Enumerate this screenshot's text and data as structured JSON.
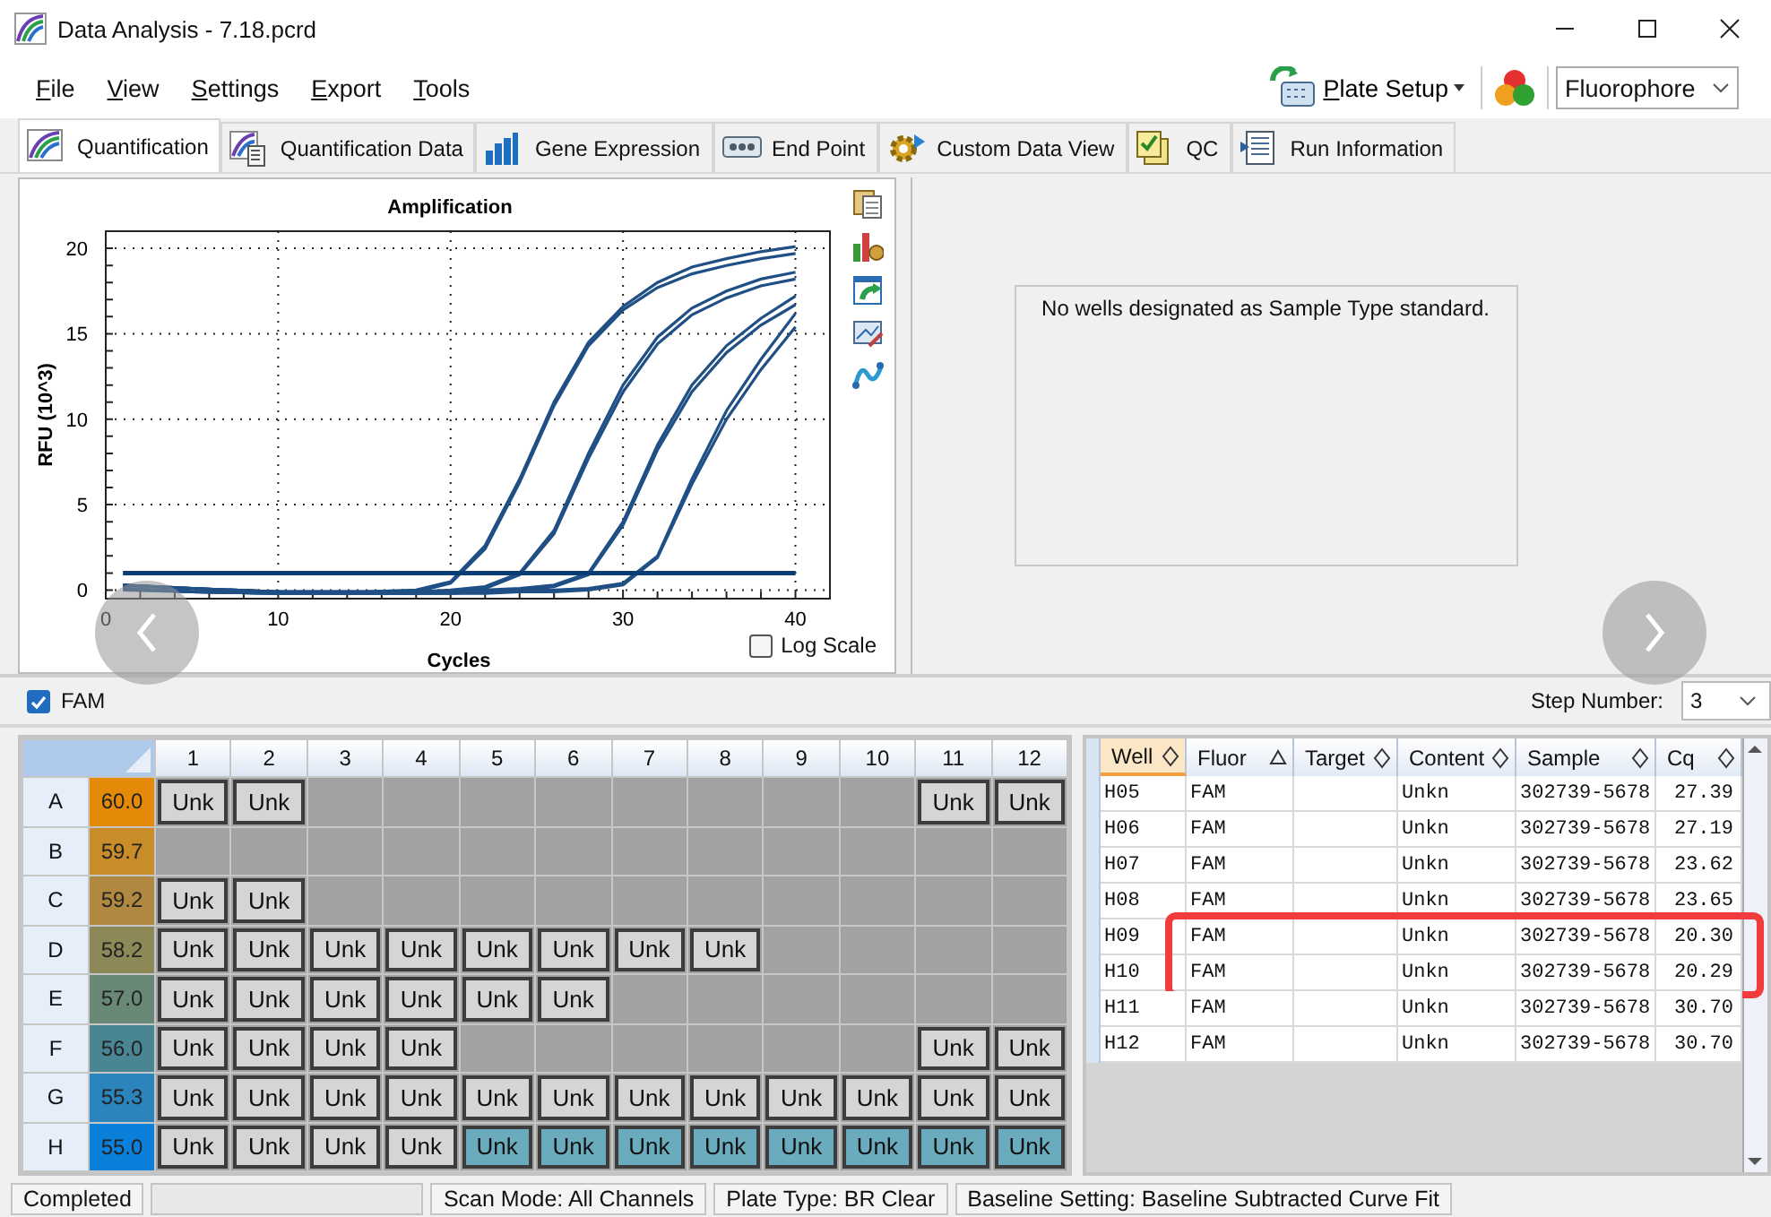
{
  "window": {
    "title": "Data Analysis - 7.18.pcrd"
  },
  "menu": [
    {
      "label": "File"
    },
    {
      "label": "View"
    },
    {
      "label": "Settings"
    },
    {
      "label": "Export"
    },
    {
      "label": "Tools"
    }
  ],
  "toolbar": {
    "plate_setup": {
      "label": "Plate Setup"
    },
    "fluorophore_select": {
      "value": "Fluorophore"
    }
  },
  "tabs": [
    {
      "label": "Quantification",
      "kind": "curves",
      "selected": true
    },
    {
      "label": "Quantification Data",
      "kind": "curves-doc",
      "selected": false
    },
    {
      "label": "Gene Expression",
      "kind": "bars",
      "selected": false
    },
    {
      "label": "End Point",
      "kind": "dots",
      "selected": false
    },
    {
      "label": "Custom Data View",
      "kind": "gear",
      "selected": false
    },
    {
      "label": "QC",
      "kind": "checklist",
      "selected": false
    },
    {
      "label": "Run Information",
      "kind": "list",
      "selected": false
    }
  ],
  "chart": {
    "chart_data": {
      "type": "line",
      "title": "Amplification",
      "xlabel": "Cycles",
      "ylabel": "RFU (10^3)",
      "grid": true,
      "x": [
        1,
        5,
        10,
        15,
        18,
        20,
        22,
        24,
        26,
        28,
        30,
        32,
        34,
        36,
        38,
        40
      ],
      "series": [
        {
          "color": "#1f4f85",
          "values": [
            0.3,
            0.1,
            -0.1,
            -0.1,
            0,
            0.5,
            2.6,
            6.5,
            11,
            14.5,
            16.6,
            18,
            18.9,
            19.4,
            19.8,
            20.1
          ]
        },
        {
          "color": "#1f4f85",
          "values": [
            0.1,
            -0.1,
            -0.2,
            -0.2,
            -0.1,
            0.4,
            2.4,
            6.3,
            10.8,
            14.3,
            16.4,
            17.7,
            18.5,
            19,
            19.4,
            19.7
          ]
        },
        {
          "color": "#1f4f85",
          "values": [
            0.3,
            0.1,
            -0.1,
            -0.1,
            -0.1,
            0,
            0.2,
            1,
            3.5,
            8,
            12,
            14.8,
            16.5,
            17.5,
            18.2,
            18.6
          ]
        },
        {
          "color": "#1f4f85",
          "values": [
            0,
            -0.1,
            -0.2,
            -0.2,
            -0.2,
            -0.1,
            0.1,
            0.9,
            3.3,
            7.7,
            11.6,
            14.4,
            16.1,
            17.1,
            17.8,
            18.2
          ]
        },
        {
          "color": "#1f4f85",
          "values": [
            0.3,
            0.1,
            -0.1,
            -0.1,
            -0.1,
            -0.1,
            0,
            0.1,
            0.3,
            1,
            4,
            8.5,
            12,
            14.3,
            15.9,
            17.2
          ]
        },
        {
          "color": "#1f4f85",
          "values": [
            0.1,
            -0.1,
            -0.2,
            -0.2,
            -0.2,
            -0.2,
            -0.1,
            0,
            0.2,
            0.9,
            3.8,
            8.2,
            11.6,
            13.9,
            15.5,
            16.7
          ]
        },
        {
          "color": "#1f4f85",
          "values": [
            0.3,
            0.1,
            -0.1,
            -0.1,
            -0.1,
            -0.1,
            -0.1,
            0,
            0,
            0.1,
            0.4,
            2,
            6.5,
            10.5,
            13.5,
            16.2
          ]
        },
        {
          "color": "#1f4f85",
          "values": [
            0.1,
            -0.1,
            -0.2,
            -0.2,
            -0.2,
            -0.2,
            -0.2,
            -0.1,
            -0.1,
            0,
            0.3,
            1.9,
            6.2,
            10,
            12.9,
            15.4
          ]
        },
        {
          "color": "#0b3d75",
          "values": [
            1,
            1,
            1,
            1,
            1,
            1,
            1,
            1,
            1,
            1,
            1,
            1,
            1,
            1,
            1,
            1
          ]
        }
      ],
      "xlim": [
        0,
        42
      ],
      "ylim": [
        -0.5,
        21
      ],
      "xticks": [
        0,
        10,
        20,
        30,
        40
      ],
      "yticks": [
        0,
        5,
        10,
        15,
        20
      ]
    },
    "log_scale": {
      "label": "Log Scale",
      "checked": false
    }
  },
  "standard_panel": {
    "message": "No wells designated as Sample Type standard."
  },
  "fluor_filter": {
    "label": "FAM",
    "checked": true
  },
  "step_number": {
    "label": "Step Number:",
    "value": "3"
  },
  "plate": {
    "columns": [
      "1",
      "2",
      "3",
      "4",
      "5",
      "6",
      "7",
      "8",
      "9",
      "10",
      "11",
      "12"
    ],
    "rows": [
      {
        "label": "A",
        "temp": "60.0",
        "color": "#e58a08",
        "wells": [
          {
            "kind": "sample",
            "label": "Unk",
            "selected": false
          },
          {
            "kind": "sample",
            "label": "Unk",
            "selected": false
          },
          {
            "kind": "empty"
          },
          {
            "kind": "empty"
          },
          {
            "kind": "empty"
          },
          {
            "kind": "empty"
          },
          {
            "kind": "empty"
          },
          {
            "kind": "empty"
          },
          {
            "kind": "empty"
          },
          {
            "kind": "empty"
          },
          {
            "kind": "sample",
            "label": "Unk",
            "selected": false
          },
          {
            "kind": "sample",
            "label": "Unk",
            "selected": false
          }
        ]
      },
      {
        "label": "B",
        "temp": "59.7",
        "color": "#c88c28",
        "wells": [
          {
            "kind": "empty"
          },
          {
            "kind": "empty"
          },
          {
            "kind": "empty"
          },
          {
            "kind": "empty"
          },
          {
            "kind": "empty"
          },
          {
            "kind": "empty"
          },
          {
            "kind": "empty"
          },
          {
            "kind": "empty"
          },
          {
            "kind": "empty"
          },
          {
            "kind": "empty"
          },
          {
            "kind": "empty"
          },
          {
            "kind": "empty"
          }
        ]
      },
      {
        "label": "C",
        "temp": "59.2",
        "color": "#b08940",
        "wells": [
          {
            "kind": "sample",
            "label": "Unk",
            "selected": false
          },
          {
            "kind": "sample",
            "label": "Unk",
            "selected": false
          },
          {
            "kind": "empty"
          },
          {
            "kind": "empty"
          },
          {
            "kind": "empty"
          },
          {
            "kind": "empty"
          },
          {
            "kind": "empty"
          },
          {
            "kind": "empty"
          },
          {
            "kind": "empty"
          },
          {
            "kind": "empty"
          },
          {
            "kind": "empty"
          },
          {
            "kind": "empty"
          }
        ]
      },
      {
        "label": "D",
        "temp": "58.2",
        "color": "#8c8858",
        "wells": [
          {
            "kind": "sample",
            "label": "Unk",
            "selected": false
          },
          {
            "kind": "sample",
            "label": "Unk",
            "selected": false
          },
          {
            "kind": "sample",
            "label": "Unk",
            "selected": false
          },
          {
            "kind": "sample",
            "label": "Unk",
            "selected": false
          },
          {
            "kind": "sample",
            "label": "Unk",
            "selected": false
          },
          {
            "kind": "sample",
            "label": "Unk",
            "selected": false
          },
          {
            "kind": "sample",
            "label": "Unk",
            "selected": false
          },
          {
            "kind": "sample",
            "label": "Unk",
            "selected": false
          },
          {
            "kind": "empty"
          },
          {
            "kind": "empty"
          },
          {
            "kind": "empty"
          },
          {
            "kind": "empty"
          }
        ]
      },
      {
        "label": "E",
        "temp": "57.0",
        "color": "#6a8876",
        "wells": [
          {
            "kind": "sample",
            "label": "Unk",
            "selected": false
          },
          {
            "kind": "sample",
            "label": "Unk",
            "selected": false
          },
          {
            "kind": "sample",
            "label": "Unk",
            "selected": false
          },
          {
            "kind": "sample",
            "label": "Unk",
            "selected": false
          },
          {
            "kind": "sample",
            "label": "Unk",
            "selected": false
          },
          {
            "kind": "sample",
            "label": "Unk",
            "selected": false
          },
          {
            "kind": "empty"
          },
          {
            "kind": "empty"
          },
          {
            "kind": "empty"
          },
          {
            "kind": "empty"
          },
          {
            "kind": "empty"
          },
          {
            "kind": "empty"
          }
        ]
      },
      {
        "label": "F",
        "temp": "56.0",
        "color": "#4a8594",
        "wells": [
          {
            "kind": "sample",
            "label": "Unk",
            "selected": false
          },
          {
            "kind": "sample",
            "label": "Unk",
            "selected": false
          },
          {
            "kind": "sample",
            "label": "Unk",
            "selected": false
          },
          {
            "kind": "sample",
            "label": "Unk",
            "selected": false
          },
          {
            "kind": "empty"
          },
          {
            "kind": "empty"
          },
          {
            "kind": "empty"
          },
          {
            "kind": "empty"
          },
          {
            "kind": "empty"
          },
          {
            "kind": "empty"
          },
          {
            "kind": "sample",
            "label": "Unk",
            "selected": false
          },
          {
            "kind": "sample",
            "label": "Unk",
            "selected": false
          }
        ]
      },
      {
        "label": "G",
        "temp": "55.3",
        "color": "#2c84bc",
        "wells": [
          {
            "kind": "sample",
            "label": "Unk",
            "selected": false
          },
          {
            "kind": "sample",
            "label": "Unk",
            "selected": false
          },
          {
            "kind": "sample",
            "label": "Unk",
            "selected": false
          },
          {
            "kind": "sample",
            "label": "Unk",
            "selected": false
          },
          {
            "kind": "sample",
            "label": "Unk",
            "selected": false
          },
          {
            "kind": "sample",
            "label": "Unk",
            "selected": false
          },
          {
            "kind": "sample",
            "label": "Unk",
            "selected": false
          },
          {
            "kind": "sample",
            "label": "Unk",
            "selected": false
          },
          {
            "kind": "sample",
            "label": "Unk",
            "selected": false
          },
          {
            "kind": "sample",
            "label": "Unk",
            "selected": false
          },
          {
            "kind": "sample",
            "label": "Unk",
            "selected": false
          },
          {
            "kind": "sample",
            "label": "Unk",
            "selected": false
          }
        ]
      },
      {
        "label": "H",
        "temp": "55.0",
        "color": "#0a80da",
        "wells": [
          {
            "kind": "sample",
            "label": "Unk",
            "selected": false
          },
          {
            "kind": "sample",
            "label": "Unk",
            "selected": false
          },
          {
            "kind": "sample",
            "label": "Unk",
            "selected": false
          },
          {
            "kind": "sample",
            "label": "Unk",
            "selected": false
          },
          {
            "kind": "sample",
            "label": "Unk",
            "selected": true
          },
          {
            "kind": "sample",
            "label": "Unk",
            "selected": true
          },
          {
            "kind": "sample",
            "label": "Unk",
            "selected": true
          },
          {
            "kind": "sample",
            "label": "Unk",
            "selected": true
          },
          {
            "kind": "sample",
            "label": "Unk",
            "selected": true
          },
          {
            "kind": "sample",
            "label": "Unk",
            "selected": true
          },
          {
            "kind": "sample",
            "label": "Unk",
            "selected": true
          },
          {
            "kind": "sample",
            "label": "Unk",
            "selected": true
          }
        ]
      }
    ]
  },
  "well_table": {
    "columns": [
      {
        "label": "Well",
        "sorted": false,
        "selected": true
      },
      {
        "label": "Fluor",
        "sorted": true,
        "selected": false
      },
      {
        "label": "Target",
        "sorted": false,
        "selected": false
      },
      {
        "label": "Content",
        "sorted": false,
        "selected": false
      },
      {
        "label": "Sample",
        "sorted": false,
        "selected": false
      },
      {
        "label": "Cq",
        "sorted": false,
        "selected": false
      }
    ],
    "rows": [
      {
        "well": "H05",
        "fluor": "FAM",
        "content": "Unkn",
        "sample": "302739-5678",
        "cq": "27.39",
        "highlighted": false
      },
      {
        "well": "H06",
        "fluor": "FAM",
        "content": "Unkn",
        "sample": "302739-5678",
        "cq": "27.19",
        "highlighted": false
      },
      {
        "well": "H07",
        "fluor": "FAM",
        "content": "Unkn",
        "sample": "302739-5678",
        "cq": "23.62",
        "highlighted": false
      },
      {
        "well": "H08",
        "fluor": "FAM",
        "content": "Unkn",
        "sample": "302739-5678",
        "cq": "23.65",
        "highlighted": false
      },
      {
        "well": "H09",
        "fluor": "FAM",
        "content": "Unkn",
        "sample": "302739-5678",
        "cq": "20.30",
        "highlighted": true
      },
      {
        "well": "H10",
        "fluor": "FAM",
        "content": "Unkn",
        "sample": "302739-5678",
        "cq": "20.29",
        "highlighted": true
      },
      {
        "well": "H11",
        "fluor": "FAM",
        "content": "Unkn",
        "sample": "302739-5678",
        "cq": "30.70",
        "highlighted": false
      },
      {
        "well": "H12",
        "fluor": "FAM",
        "content": "Unkn",
        "sample": "302739-5678",
        "cq": "30.70",
        "highlighted": false
      }
    ]
  },
  "status_bar": [
    {
      "kind": "text",
      "text": "Completed"
    },
    {
      "kind": "blank"
    },
    {
      "kind": "text",
      "text": "Scan Mode: All Channels"
    },
    {
      "kind": "text",
      "text": "Plate Type: BR Clear"
    },
    {
      "kind": "text",
      "text": "Baseline Setting: Baseline Subtracted Curve Fit"
    }
  ]
}
